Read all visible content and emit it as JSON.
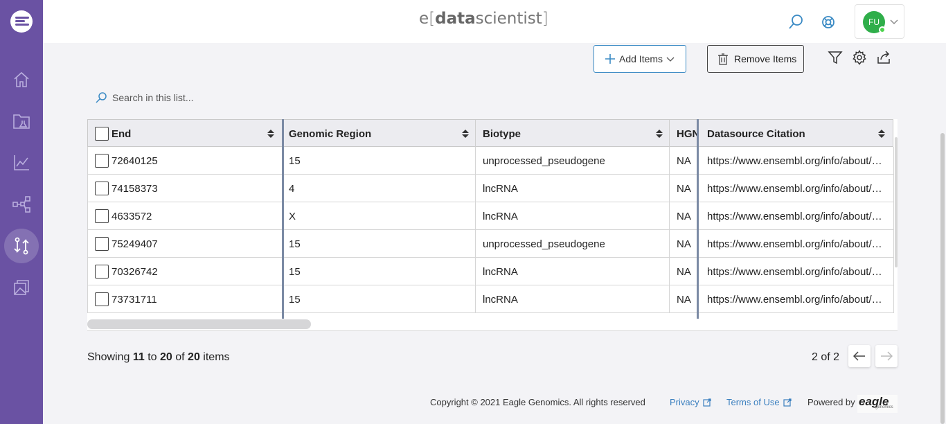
{
  "app": {
    "brand_prefix": "e",
    "brand_bold": "data",
    "brand_rest": "scientist",
    "user_initials": "FU"
  },
  "sidebar": {
    "items": [
      "home-icon",
      "projects-icon",
      "analytics-icon",
      "network-icon",
      "compare-icon",
      "archive-icon"
    ],
    "active": "compare-icon"
  },
  "toolbar": {
    "add_label": "Add Items",
    "remove_label": "Remove Items"
  },
  "search": {
    "placeholder": "Search in this list..."
  },
  "table": {
    "columns": [
      "End",
      "Genomic Region",
      "Biotype",
      "HGNC",
      "Datasource Citation"
    ],
    "rows": [
      {
        "end": "72640125",
        "region": "15",
        "biotype": "unprocessed_pseudogene",
        "hgnc": "NA",
        "citation": "https://www.ensembl.org/info/about/publications.html"
      },
      {
        "end": "74158373",
        "region": "4",
        "biotype": "lncRNA",
        "hgnc": "NA",
        "citation": "https://www.ensembl.org/info/about/publications.html"
      },
      {
        "end": "4633572",
        "region": "X",
        "biotype": "lncRNA",
        "hgnc": "NA",
        "citation": "https://www.ensembl.org/info/about/publications.html"
      },
      {
        "end": "75249407",
        "region": "15",
        "biotype": "unprocessed_pseudogene",
        "hgnc": "NA",
        "citation": "https://www.ensembl.org/info/about/publications.html"
      },
      {
        "end": "70326742",
        "region": "15",
        "biotype": "lncRNA",
        "hgnc": "NA",
        "citation": "https://www.ensembl.org/info/about/publications.html"
      },
      {
        "end": "73731711",
        "region": "15",
        "biotype": "lncRNA",
        "hgnc": "NA",
        "citation": "https://www.ensembl.org/info/about/publications.html"
      }
    ]
  },
  "pagination": {
    "showing_prefix": "Showing",
    "from": "11",
    "to_word": "to",
    "to": "20",
    "of_word": "of",
    "total": "20",
    "items_word": "items",
    "page_text": "2 of 2"
  },
  "footer": {
    "copyright": "Copyright © 2021 Eagle Genomics. All rights reserved",
    "privacy": "Privacy",
    "terms": "Terms of Use",
    "powered_by": "Powered by",
    "logo_text": "eagle",
    "logo_sub": "genomics"
  },
  "colors": {
    "sidebar": "#6a52a3",
    "accent": "#3a8ac4",
    "avatar": "#2fae4a"
  }
}
